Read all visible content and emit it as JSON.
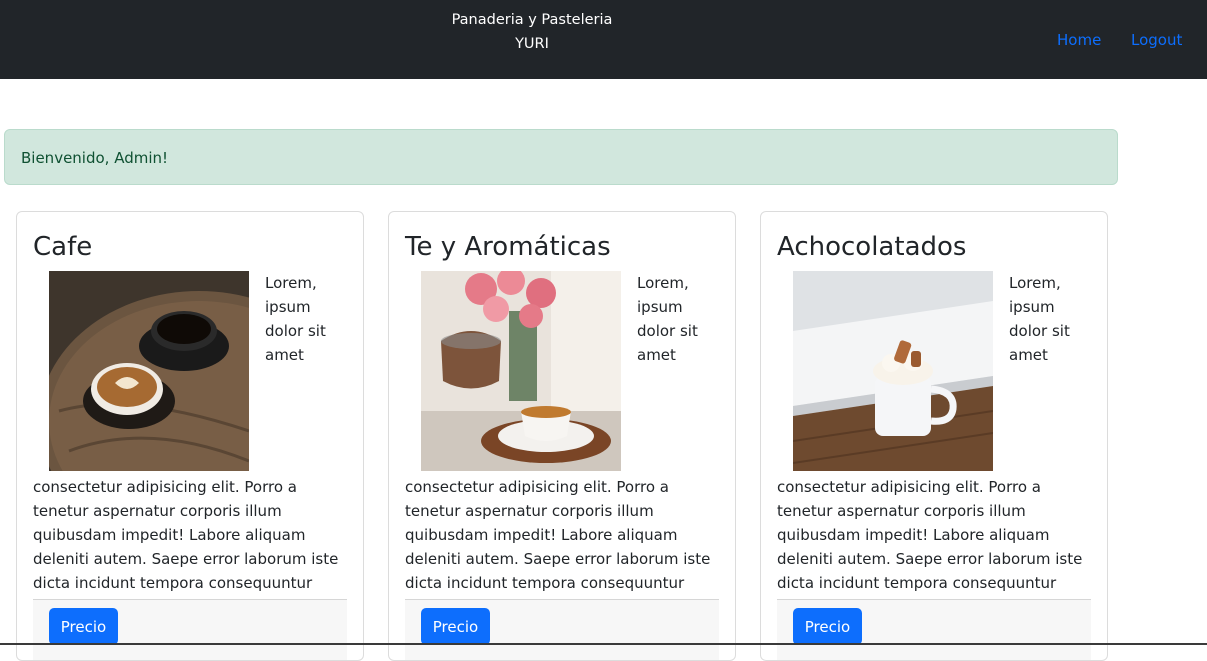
{
  "navbar": {
    "brand_line1": "Panaderia y Pasteleria",
    "brand_line2": "YURI",
    "links": [
      "Home",
      "Logout"
    ],
    "link_color": "#0d6efd"
  },
  "alert": {
    "text": "Bienvenido, Admin!",
    "color": "#d1e7dd"
  },
  "cards": [
    {
      "title": "Cafe",
      "image": "two coffee cups with latte art on a wooden table",
      "text": "Lorem, ipsum dolor sit amet consectetur adipisicing elit. Porro a tenetur aspernatur corporis illum quibusdam impedit! Labore aliquam deleniti autem. Saepe error laborum iste dicta incidunt tempora consequuntur voluptates ut.",
      "button": "Precio"
    },
    {
      "title": "Te y Aromáticas",
      "image": "tea being poured into a teacup next to pink roses",
      "text": "Lorem, ipsum dolor sit amet consectetur adipisicing elit. Porro a tenetur aspernatur corporis illum quibusdam impedit! Labore aliquam deleniti autem. Saepe error laborum iste dicta incidunt tempora consequuntur voluptates ut.",
      "button": "Precio"
    },
    {
      "title": "Achocolatados",
      "image": "white mug with whipped cream on a wooden floor",
      "text": "Lorem, ipsum dolor sit amet consectetur adipisicing elit. Porro a tenetur aspernatur corporis illum quibusdam impedit! Labore aliquam deleniti autem. Saepe error laborum iste dicta incidunt tempora consequuntur voluptates ut.",
      "button": "Precio"
    }
  ]
}
